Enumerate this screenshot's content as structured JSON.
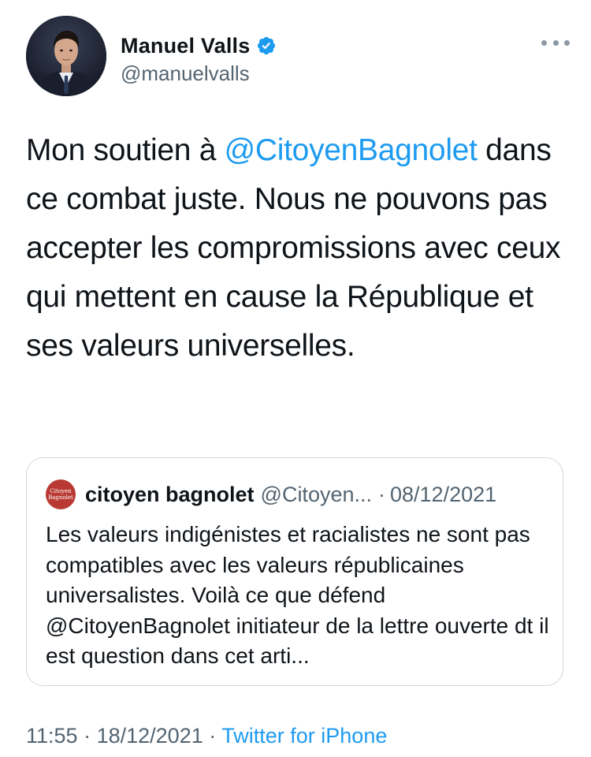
{
  "author": {
    "name": "Manuel Valls",
    "handle": "@manuelvalls",
    "avatar_icon": "profile-photo-icon",
    "verified_icon": "verified-badge-icon",
    "verified_color": "#1d9bf0"
  },
  "more_icon": "more-options-icon",
  "tweet": {
    "text_before_mention": "Mon soutien à ",
    "mention": "@CitoyenBagnolet",
    "text_after_mention": " dans ce combat juste. Nous ne pouvons pas accepter les compromissions avec ceux qui mettent en cause la République et ses valeurs universelles."
  },
  "quoted_tweet": {
    "avatar_text_line1": "Citoyen",
    "avatar_text_line2": "Bagnolet",
    "name": "citoyen bagnolet",
    "handle": "@Citoyen...",
    "separator": "·",
    "date": "08/12/2021",
    "text": "Les valeurs indigénistes et racialistes ne sont pas compatibles avec les valeurs républicaines universalistes. Voilà ce que défend @CitoyenBagnolet initiateur de la lettre ouverte dt il est question dans cet arti..."
  },
  "footer": {
    "time": "11:55",
    "separator": "·",
    "date": "18/12/2021",
    "source": "Twitter for iPhone"
  },
  "colors": {
    "link": "#1d9bf0",
    "secondary_text": "#536471",
    "border": "#cfd9de",
    "quote_avatar_bg": "#b93a32"
  }
}
